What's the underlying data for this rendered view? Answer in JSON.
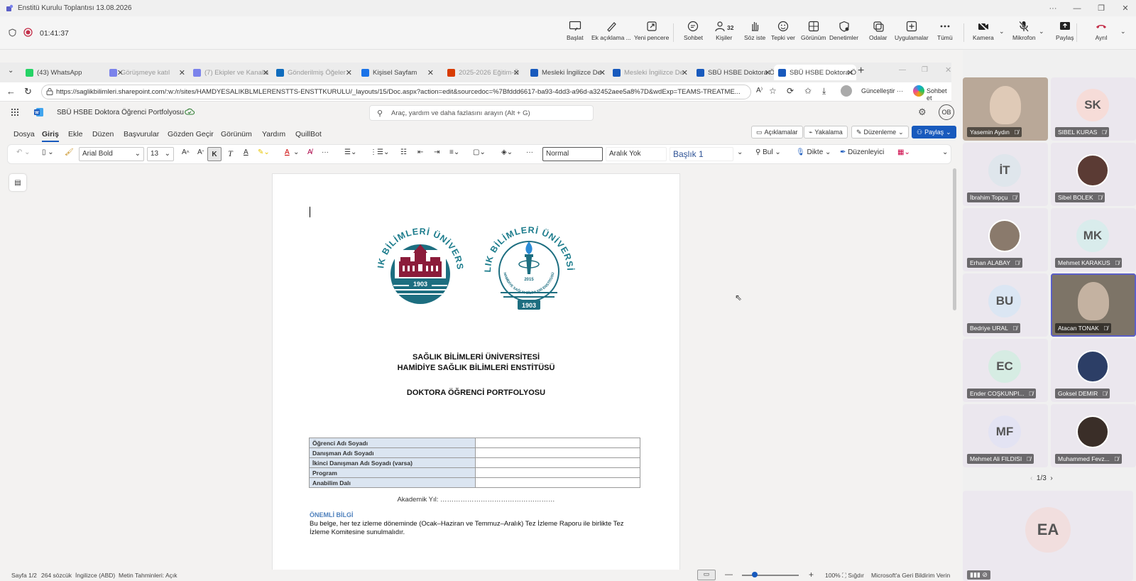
{
  "window": {
    "title": "Enstitü Kurulu Toplantısı 13.08.2026"
  },
  "meeting": {
    "timer": "01:41:37",
    "tools": [
      {
        "label": "Başlat",
        "icon": "screen-start-icon"
      },
      {
        "label": "Ek açıklama ...",
        "icon": "pen-icon"
      },
      {
        "label": "Yeni pencere",
        "icon": "new-window-icon"
      },
      {
        "label": "Sohbet",
        "icon": "chat-icon"
      },
      {
        "label": "Kişiler",
        "icon": "people-icon",
        "badge": "32"
      },
      {
        "label": "Söz iste",
        "icon": "raise-hand-icon"
      },
      {
        "label": "Tepki ver",
        "icon": "smile-icon"
      },
      {
        "label": "Görünüm",
        "icon": "grid-view-icon"
      },
      {
        "label": "Denetimler",
        "icon": "controls-icon"
      },
      {
        "label": "Odalar",
        "icon": "rooms-icon"
      },
      {
        "label": "Uygulamalar",
        "icon": "add-apps-icon"
      },
      {
        "label": "Tümü",
        "icon": "more-icon"
      },
      {
        "label": "Kamera",
        "icon": "camera-off-icon"
      },
      {
        "label": "Mikrofon",
        "icon": "mic-off-icon"
      },
      {
        "label": "Paylaş",
        "icon": "share-icon"
      },
      {
        "label": "Ayrıl",
        "icon": "hangup-icon"
      }
    ]
  },
  "browser": {
    "tabs": [
      {
        "label": "(43) WhatsApp",
        "color": "#25d366"
      },
      {
        "label": "Görüşmeye katıl",
        "color": "#7b83eb"
      },
      {
        "label": "(7) Ekipler ve Kanalla",
        "color": "#7b83eb"
      },
      {
        "label": "Gönderilmiş Öğeler",
        "color": "#0f6cbd"
      },
      {
        "label": "Kişisel Sayfam",
        "color": "#1a73e8"
      },
      {
        "label": "2025-2026 Eğitim-Ö",
        "color": "#d83b01"
      },
      {
        "label": "Mesleki İngilizce De",
        "color": "#185abd"
      },
      {
        "label": "Mesleki İngilizce De",
        "color": "#185abd"
      },
      {
        "label": "SBÜ HSBE Doktora Ö",
        "color": "#185abd"
      },
      {
        "label": "SBÜ HSBE Doktora Ö",
        "color": "#185abd"
      }
    ],
    "url": "https://saglikbilimleri.sharepoint.com/:w:/r/sites/HAMDYESALIKBLMLERENSTTS-ENSTTKURULU/_layouts/15/Doc.aspx?action=edit&sourcedoc=%7Bfddd6617-ba93-4dd3-a96d-a32452aee5a8%7D&wdExp=TEAMS-TREATME...",
    "update_label": "Güncelleştir",
    "copilot_label": "Sohbet et"
  },
  "word": {
    "doc_title": "SBÜ HSBE Doktora Öğrenci Portfolyosu",
    "search_placeholder": "Araç, yardım ve daha fazlasını arayın (Alt + G)",
    "user_initials": "OB",
    "menus": [
      "Dosya",
      "Giriş",
      "Ekle",
      "Düzen",
      "Başvurular",
      "Gözden Geçir",
      "Görünüm",
      "Yardım",
      "QuillBot"
    ],
    "right_buttons": {
      "comments": "Açıklamalar",
      "catchup": "Yakalama",
      "editing": "Düzenleme",
      "share": "Paylaş"
    },
    "ribbon": {
      "font": "Arial Bold",
      "size": "13",
      "styles": [
        "Normal",
        "Aralık Yok",
        "Başlık 1"
      ],
      "find": "Bul",
      "dictate": "Dikte",
      "editor": "Düzenleyici"
    }
  },
  "document": {
    "university": "SAĞLIK BİLİMLERİ ÜNİVERSİTESİ",
    "institute": "HAMİDİYE SAĞLIK BİLİMLERİ ENSTİTÜSÜ",
    "portfolio_title": "DOKTORA ÖĞRENCİ PORTFOLYOSU",
    "logo_left": {
      "arc": "SAĞLIK BİLİMLERİ ÜNİVERSİTESİ",
      "year": "1903"
    },
    "logo_right": {
      "arc": "SAĞLIK BİLİMLERİ ÜNİVERSİTESİ",
      "inner": "HAMİDİYE SAĞLIK BİLİMLERİ ENSTİTÜSÜ",
      "year_small": "2015",
      "year": "1903"
    },
    "form_rows": [
      "Öğrenci Adı Soyadı",
      "Danışman Adı Soyadı",
      "İkinci Danışman Adı Soyadı (varsa)",
      "Program",
      "Anabilim Dalı"
    ],
    "academic_year_label": "Akademik Yıl: ……………………………………………",
    "notice_title": "ÖNEMLİ BİLGİ",
    "notice_text_1": "Bu belge, her tez izleme döneminde (Ocak–Haziran ve Temmuz–Aralık) Tez İzleme Raporu ile birlikte Tez",
    "notice_text_2": "İzleme Komitesine sunulmalıdır."
  },
  "status": {
    "page": "Sayfa 1/2",
    "words": "264 sözcük",
    "language": "İngilizce (ABD)",
    "predictions": "Metin Tahminleri: Açık",
    "zoom": "100%",
    "fit": "Sığdır",
    "feedback": "Microsoft'a Geri Bildirim Verin"
  },
  "participants": [
    {
      "name": "Yasemin Aydın",
      "initials": "",
      "video": true,
      "bg": "#b9a898"
    },
    {
      "name": "SIBEL KURAS",
      "initials": "SK",
      "video": false,
      "bg": "#f6dcd8"
    },
    {
      "name": "İbrahim Topçu",
      "initials": "İT",
      "video": false,
      "bg": "#dfe6ec"
    },
    {
      "name": "Sibel BOLEK",
      "initials": "",
      "video": false,
      "bg": "#5b3b34"
    },
    {
      "name": "Erhan ALABAY",
      "initials": "",
      "video": false,
      "bg": "#8a7a6c"
    },
    {
      "name": "Mehmet KARAKUS",
      "initials": "MK",
      "video": false,
      "bg": "#d9ecec"
    },
    {
      "name": "Bedriye URAL",
      "initials": "BU",
      "video": false,
      "bg": "#dbe6f3"
    },
    {
      "name": "Atacan TONAK",
      "initials": "",
      "video": true,
      "bg": "#7d7467"
    },
    {
      "name": "Ender COŞKUNPI...",
      "initials": "EC",
      "video": false,
      "bg": "#d6ece3"
    },
    {
      "name": "Goksel DEMIR",
      "initials": "",
      "video": false,
      "bg": "#2c3e66"
    },
    {
      "name": "Mehmet Ali FILDISI",
      "initials": "MF",
      "video": false,
      "bg": "#e3e3f3"
    },
    {
      "name": "Muhammed Fevz...",
      "initials": "",
      "video": false,
      "bg": "#3a2e28"
    }
  ],
  "gallery_page": "1/3",
  "self_view": {
    "initials": "EA"
  }
}
